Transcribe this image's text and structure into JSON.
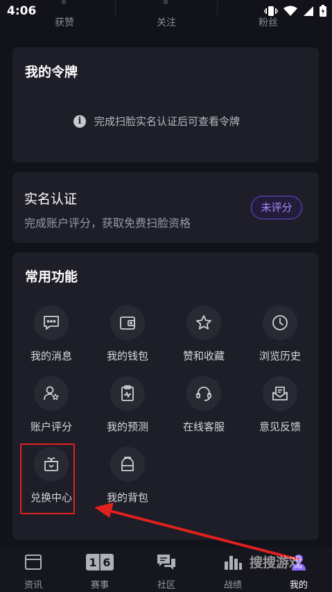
{
  "status_bar": {
    "time": "4:06"
  },
  "stats": [
    {
      "label": "获赞"
    },
    {
      "label": "关注"
    },
    {
      "label": "粉丝"
    }
  ],
  "token_card": {
    "title": "我的令牌",
    "hint": "完成扫脸实名认证后可查看令牌"
  },
  "verify_card": {
    "title": "实名认证",
    "subtitle": "完成账户评分，获取免费扫脸资格",
    "badge": "未评分"
  },
  "functions": {
    "title": "常用功能",
    "items": [
      {
        "label": "我的消息",
        "icon": "message-icon"
      },
      {
        "label": "我的钱包",
        "icon": "wallet-icon"
      },
      {
        "label": "赞和收藏",
        "icon": "star-icon"
      },
      {
        "label": "浏览历史",
        "icon": "clock-icon"
      },
      {
        "label": "账户评分",
        "icon": "user-star-icon"
      },
      {
        "label": "我的预测",
        "icon": "clipboard-chart-icon"
      },
      {
        "label": "在线客服",
        "icon": "headset-icon"
      },
      {
        "label": "意见反馈",
        "icon": "mail-feedback-icon"
      },
      {
        "label": "兑换中心",
        "icon": "gift-icon"
      },
      {
        "label": "我的背包",
        "icon": "backpack-icon"
      }
    ]
  },
  "tabbar": [
    {
      "label": "资讯",
      "icon": "news-icon"
    },
    {
      "label": "赛事",
      "icon": "scoreboard-icon"
    },
    {
      "label": "社区",
      "icon": "chat-icon"
    },
    {
      "label": "战绩",
      "icon": "stats-icon"
    },
    {
      "label": "我的",
      "icon": "profile-icon"
    }
  ],
  "scoreboard_digits": "16",
  "watermark": "搜搜游戏",
  "colors": {
    "accent": "#6a4cdc",
    "highlight": "#e0211f",
    "background": "#12121a",
    "card": "#1e1e28"
  }
}
